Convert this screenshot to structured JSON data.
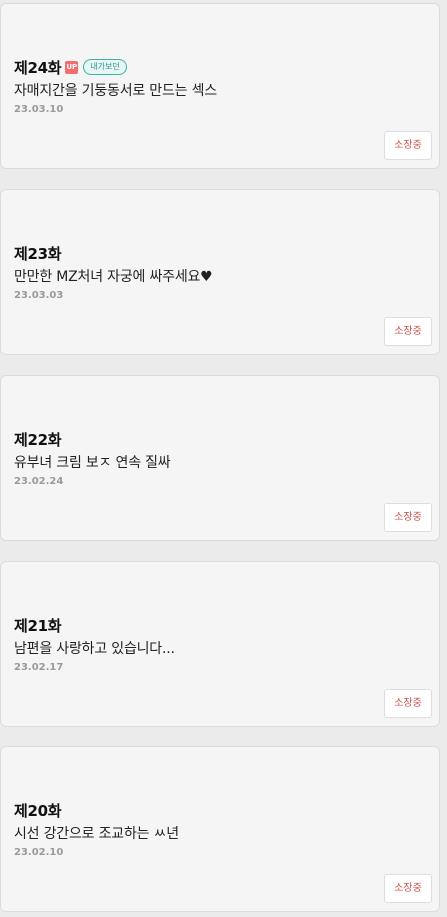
{
  "episodes": [
    {
      "title": "제24화",
      "up_badge": "UP",
      "tag": "내가보던",
      "subtitle": "자매지간을 기둥동서로 만드는 섹스",
      "date": "23.03.10",
      "button_label": "소장중"
    },
    {
      "title": "제23화",
      "subtitle": "만만한 MZ처녀 자궁에 싸주세요♥",
      "date": "23.03.03",
      "button_label": "소장중"
    },
    {
      "title": "제22화",
      "subtitle": "유부녀 크림 보ㅈ 연속 질싸",
      "date": "23.02.24",
      "button_label": "소장중"
    },
    {
      "title": "제21화",
      "subtitle": "남편을 사랑하고 있습니다...",
      "date": "23.02.17",
      "button_label": "소장중"
    },
    {
      "title": "제20화",
      "subtitle": "시선 강간으로 조교하는 ㅆ년",
      "date": "23.02.10",
      "button_label": "소장중"
    }
  ],
  "colors": {
    "up_badge": "#f26d6d",
    "tag_border": "#3bb3a8",
    "button_text": "#c9524e"
  }
}
